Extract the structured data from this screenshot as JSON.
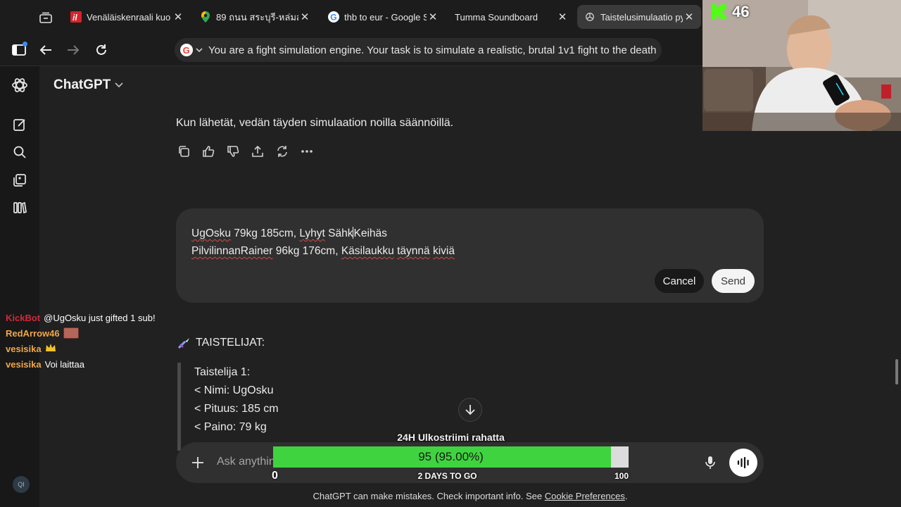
{
  "browser": {
    "tabs": [
      {
        "label": "Venäläiskenraali kuo",
        "icon": "il-icon",
        "color": "#d8232a"
      },
      {
        "label": "89 ถนน สระบุรี-หล่มสั",
        "icon": "map-pin-icon",
        "color": "#34a853"
      },
      {
        "label": "thb to eur - Google S",
        "icon": "google-icon",
        "color": "#4285f4"
      },
      {
        "label": "Tumma Soundboard",
        "icon": "",
        "color": ""
      },
      {
        "label": "Taistelusimulaatio py",
        "icon": "openai-icon",
        "color": "#ffffff"
      }
    ],
    "close_glyph": "✕",
    "omnibox_text": "You are a fight simulation engine.  Your task is to simulate a realistic, brutal 1v1 fight to the death"
  },
  "chatgpt": {
    "model_label": "ChatGPT",
    "previous_reply": "Kun lähetät, vedän täyden simulaation noilla säännöillä.",
    "edit": {
      "line1_a": "UgOsku",
      "line1_b": " 79kg 185cm, ",
      "line1_c": "Lyhyt",
      "line1_d": " Sähk",
      "line1_e": "Keihäs",
      "line2_a": "PilvilinnanRainer",
      "line2_b": " 96kg 176cm, ",
      "line2_c": "Käsilaukku",
      "line2_d": " ",
      "line2_e": "täynnä",
      "line2_f": " ",
      "line2_g": "kiviä",
      "cancel_label": "Cancel",
      "send_label": "Send"
    },
    "response": {
      "heading": "TAISTELIJAT:",
      "fighter_title": "Taistelija 1:",
      "lines": [
        "< Nimi: UgOsku",
        "< Pituus: 185 cm",
        "< Paino: 79 kg"
      ]
    },
    "composer_placeholder": "Ask anything",
    "disclaimer": "ChatGPT can make mistakes. Check important info. See ",
    "disclaimer_link": "Cookie Preferences",
    "disclaimer_end": "."
  },
  "overlay": {
    "goal_title": "24H Ulkostriimi rahatta",
    "goal_value_text": "95 (95.00%)",
    "goal_fraction": 0.95,
    "goal_min": "0",
    "goal_sub": "2 DAYS TO GO",
    "goal_max": "100",
    "goal_color": "#3fd43f",
    "kick_count": "46",
    "kick_color": "#53fc18"
  },
  "chat": [
    {
      "user": "KickBot",
      "color": "#d12a3a",
      "message": "@UgOsku just gifted 1 sub!"
    },
    {
      "user": "RedArrow46",
      "color": "#f0a64a",
      "message": ""
    },
    {
      "user": "vesisika",
      "color": "#f0a64a",
      "message": ""
    },
    {
      "user": "vesisika",
      "color": "#f0a64a",
      "message": "Voi laittaa"
    }
  ],
  "sidebar": {
    "badge": "QI"
  }
}
